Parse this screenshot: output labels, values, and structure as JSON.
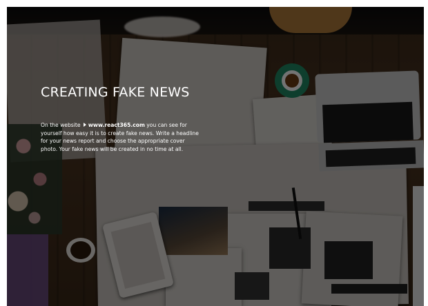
{
  "hero": {
    "title": "CREATING FAKE NEWS",
    "text_before_link": "On the website ",
    "link_icon": "arrow-right-icon",
    "link_text": "www.react365.com",
    "text_after_link": " you can see for yourself how easy it is to create fake news. Write a headline for your news report and choose the appropriate cover photo. Your fake news will be created in no time at all."
  },
  "background": {
    "description_tags": [
      "desk",
      "newspapers",
      "laptop",
      "cup",
      "tablet",
      "flowers"
    ],
    "overlay_color": "#000000",
    "overlay_opacity": 0.55
  }
}
